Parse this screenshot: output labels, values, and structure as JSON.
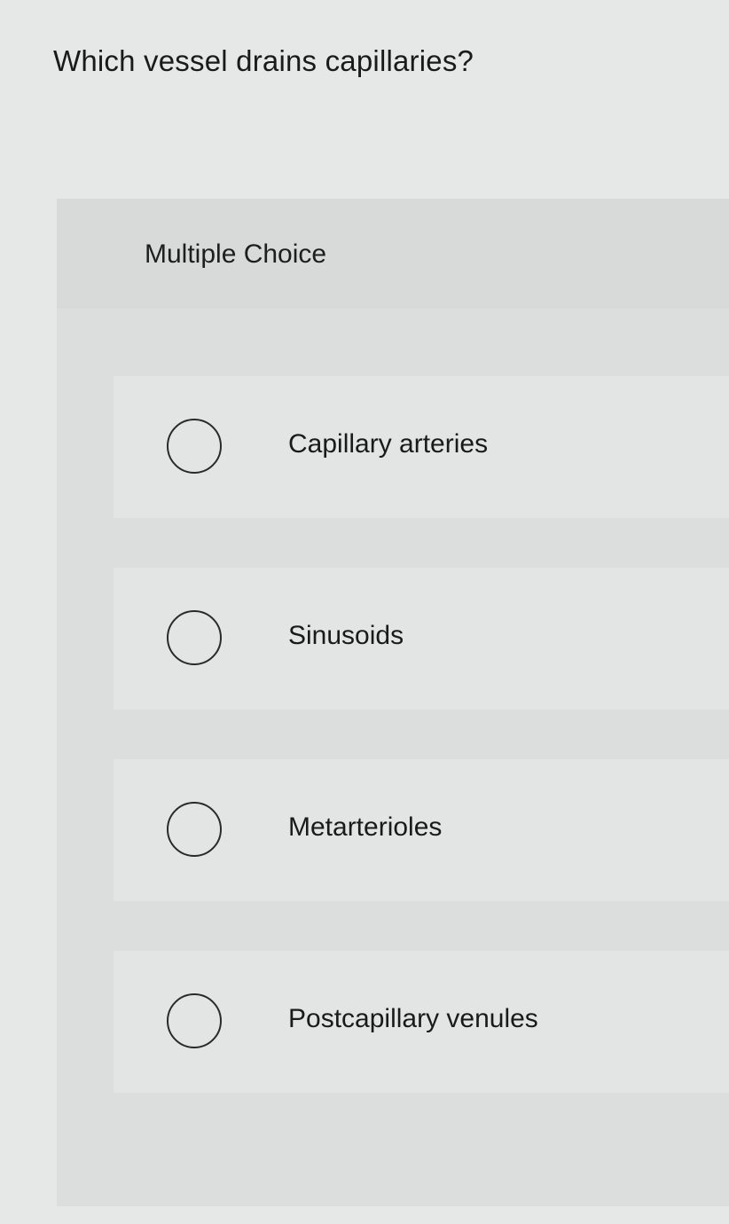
{
  "question": {
    "text": "Which vessel drains capillaries?"
  },
  "panel": {
    "label": "Multiple Choice"
  },
  "options": [
    {
      "label": "Capillary arteries",
      "selected": false
    },
    {
      "label": "Sinusoids",
      "selected": false
    },
    {
      "label": "Metarterioles",
      "selected": false
    },
    {
      "label": "Postcapillary venules",
      "selected": false
    }
  ]
}
